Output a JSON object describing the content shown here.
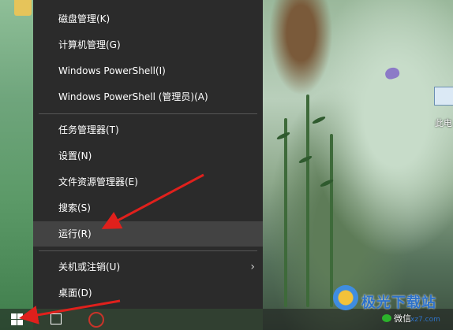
{
  "menu": {
    "items": [
      {
        "label": "磁盘管理(K)"
      },
      {
        "label": "计算机管理(G)"
      },
      {
        "label": "Windows PowerShell(I)"
      },
      {
        "label": "Windows PowerShell (管理员)(A)"
      },
      {
        "label": "任务管理器(T)"
      },
      {
        "label": "设置(N)"
      },
      {
        "label": "文件资源管理器(E)"
      },
      {
        "label": "搜索(S)"
      },
      {
        "label": "运行(R)",
        "highlighted": true
      },
      {
        "label": "关机或注销(U)",
        "has_submenu": true
      },
      {
        "label": "桌面(D)"
      }
    ]
  },
  "desktop": {
    "pc_icon_label": "此电",
    "watermark_text": "极光下载站",
    "watermark_url": "xz7.com",
    "wechat_label": "微信"
  },
  "colors": {
    "menu_bg": "#2b2b2b",
    "menu_hover": "#434343",
    "arrow": "#e0201c"
  },
  "icons": {
    "start": "windows-logo-icon",
    "submenu": "chevron-right-icon"
  }
}
